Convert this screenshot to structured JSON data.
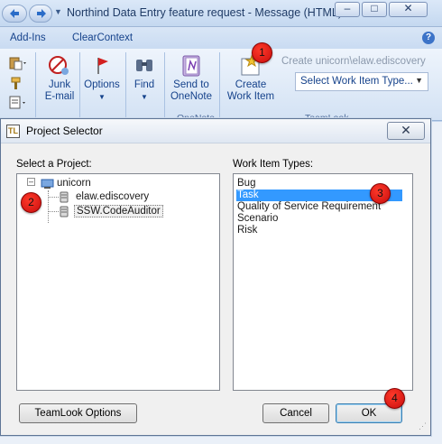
{
  "outlook": {
    "window_title": "Northind Data Entry feature request - Message (HTML)",
    "tabs": [
      "Add-Ins",
      "ClearContext"
    ],
    "help_label": "?",
    "buttons": {
      "junk": "Junk",
      "junk_sub": "E-mail",
      "options": "Options",
      "find": "Find",
      "send_onenote_1": "Send to",
      "send_onenote_2": "OneNote",
      "create_1": "Create",
      "create_2": "Work Item"
    },
    "create_unicorn": "Create unicorn\\elaw.ediscovery",
    "select_work_item": "Select Work Item Type...",
    "group_labels": [
      "OneNote",
      "TeamLook"
    ]
  },
  "dialog": {
    "title": "Project Selector",
    "title_icon": "TL",
    "select_project_label": "Select a Project:",
    "work_item_types_label": "Work Item Types:",
    "tree": {
      "root": "unicorn",
      "children": [
        "elaw.ediscovery",
        "SSW.CodeAuditor"
      ]
    },
    "work_item_types": [
      "Bug",
      "Task",
      "Quality of Service Requirement",
      "Scenario",
      "Risk"
    ],
    "selected_type": "Task",
    "buttons": {
      "teamlook_options": "TeamLook Options",
      "cancel": "Cancel",
      "ok": "OK"
    }
  },
  "badges": [
    "1",
    "2",
    "3",
    "4"
  ],
  "colors": {
    "selection": "#3399ff",
    "badge": "#e8231a",
    "ribbon_text": "#15428b"
  }
}
